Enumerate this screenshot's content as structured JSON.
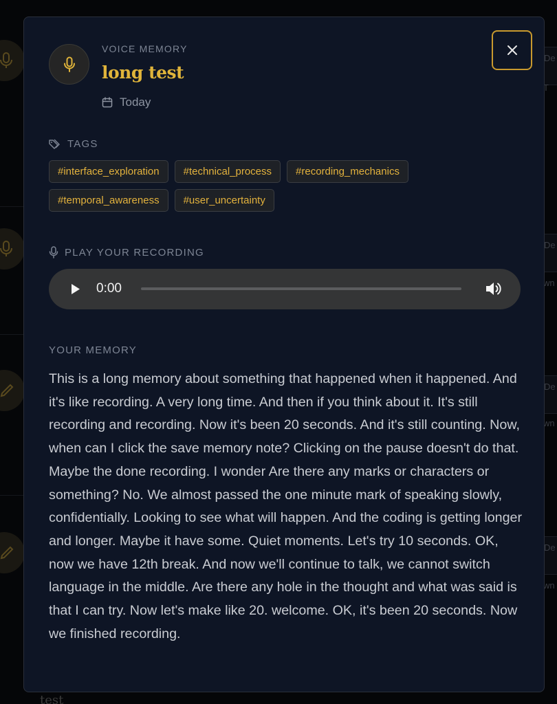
{
  "background": {
    "bottom_peek_text": "test",
    "edge_snippets": [
      "De",
      "T",
      "De",
      "wn",
      "De",
      "wn",
      "De",
      "wn"
    ]
  },
  "modal": {
    "kicker": "VOICE MEMORY",
    "title": "long test",
    "date": "Today",
    "close_icon": "close-icon",
    "accent_color": "#e0b43a",
    "tags_label": "TAGS",
    "tags": [
      "#interface_exploration",
      "#technical_process",
      "#recording_mechanics",
      "#temporal_awareness",
      "#user_uncertainty"
    ],
    "recording_label": "PLAY YOUR RECORDING",
    "player": {
      "current_time": "0:00",
      "progress": 0
    },
    "memory_label": "YOUR MEMORY",
    "memory_text": "This is a long memory about something that happened when it happened. And it's like recording. A very long time. And then if you think about it. It's still recording and recording. Now it's been 20 seconds. And it's still counting. Now, when can I click the save memory note? Clicking on the pause doesn't do that. Maybe the done recording. I wonder Are there any marks or characters or something? No. We almost passed the one minute mark of speaking slowly, confidentially. Looking to see what will happen. And the coding is getting longer and longer. Maybe it have some. Quiet moments. Let's try 10 seconds. OK, now we have 12th break. And now we'll continue to talk, we cannot switch language in the middle. Are there any hole in the thought and what was said is that I can try. Now let's make like 20. welcome. OK, it's been 20 seconds. Now we finished recording."
  }
}
